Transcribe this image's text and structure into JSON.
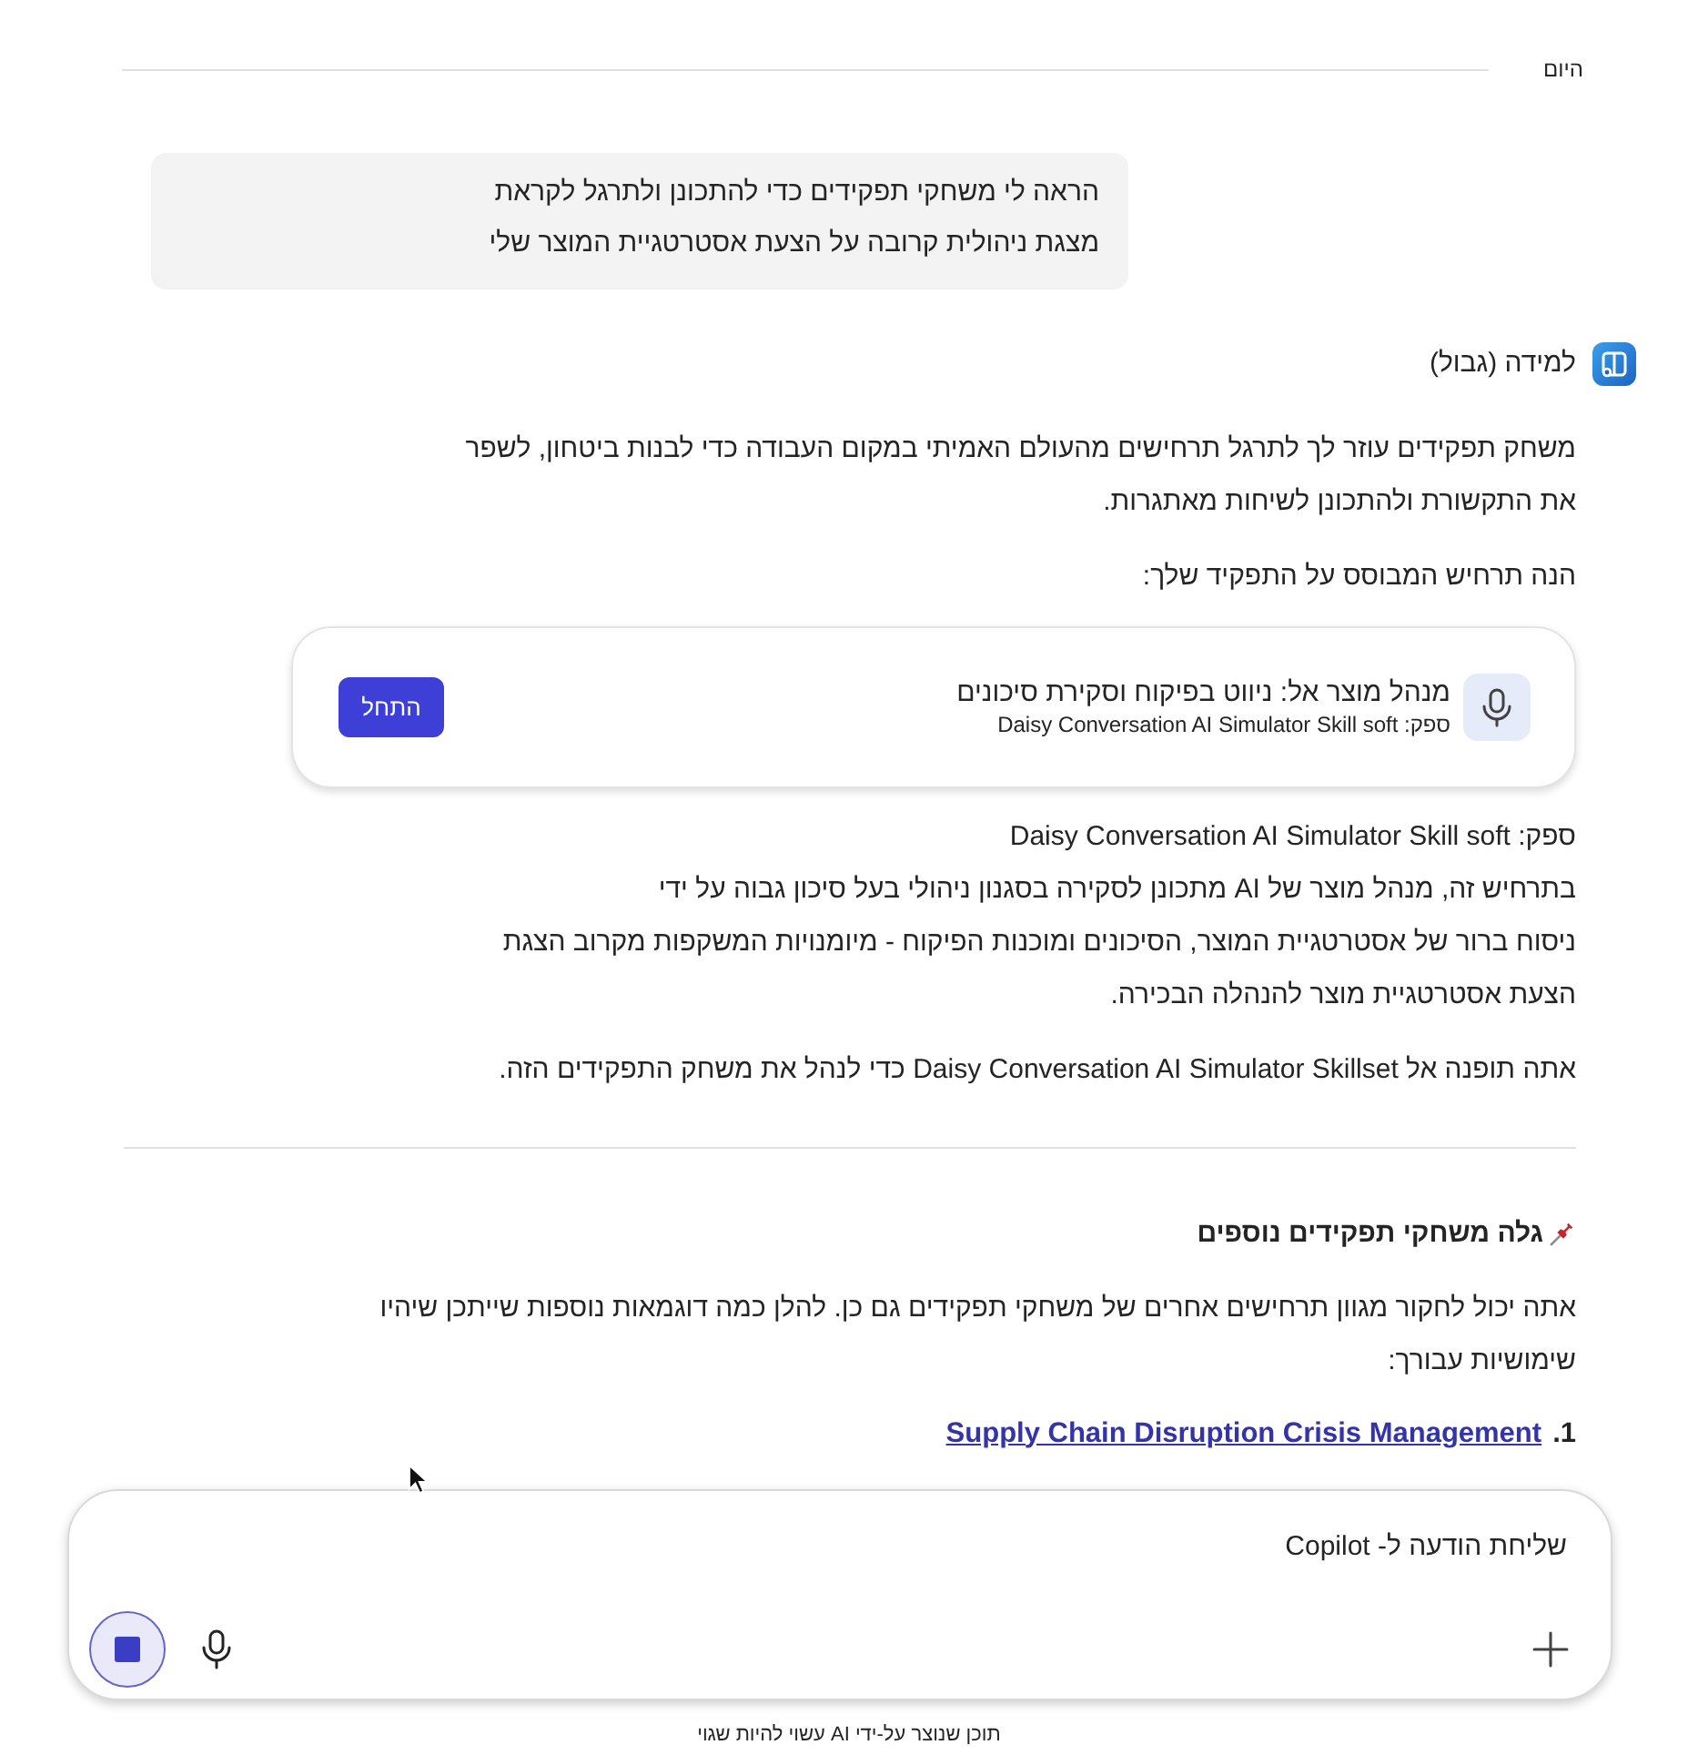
{
  "date_divider": {
    "label": "היום"
  },
  "user_message": {
    "text": "הראה לי משחקי תפקידים כדי להתכונן ולתרגל לקראת מצגת ניהולית קרובה על הצעת אסטרטגיית המוצר שלי"
  },
  "assistant": {
    "name": "למידה (גבול)"
  },
  "response": {
    "intro": "משחק תפקידים עוזר לך לתרגל תרחישים מהעולם האמיתי במקום העבודה כדי לבנות ביטחון, לשפר\nאת התקשורת ולהתכונן לשיחות מאתגרות.",
    "lead_in": "הנה תרחיש המבוסס על התפקיד שלך:",
    "scenario_card": {
      "title": "מנהל מוצר אל: ניווט בפיקוח וסקירת סיכונים",
      "provider": "ספק: Daisy Conversation AI Simulator Skill soft",
      "button": "התחל"
    },
    "provider": "ספק: Daisy Conversation AI Simulator Skill soft",
    "description": "בתרחיש זה, מנהל מוצר של AI מתכונן לסקירה בסגנון ניהולי בעל סיכון גבוה על ידי\nניסוח ברור של אסטרטגיית המוצר, הסיכונים ומוכנות הפיקוח - מיומנויות המשקפות מקרוב הצגת\nהצעת אסטרטגיית מוצר להנהלה הבכירה.",
    "redirect_note": "אתה תופנה אל Daisy Conversation AI Simulator Skillset כדי לנהל את משחק התפקידים הזה."
  },
  "more_roleplays": {
    "heading": "גלה משחקי תפקידים נוספים",
    "text": "אתה יכול לחקור מגוון תרחישים אחרים של משחקי תפקידים גם כן. להלן כמה דוגמאות נוספות שייתכן שיהיו\nשימושיות עבורך:",
    "items": [
      {
        "number": "1.",
        "title": "Supply Chain Disruption Crisis Management"
      }
    ]
  },
  "composer": {
    "placeholder": "שליחת הודעה ל- Copilot"
  },
  "disclaimer": "תוכן שנוצר על-ידי AI עשוי להיות שגוי"
}
